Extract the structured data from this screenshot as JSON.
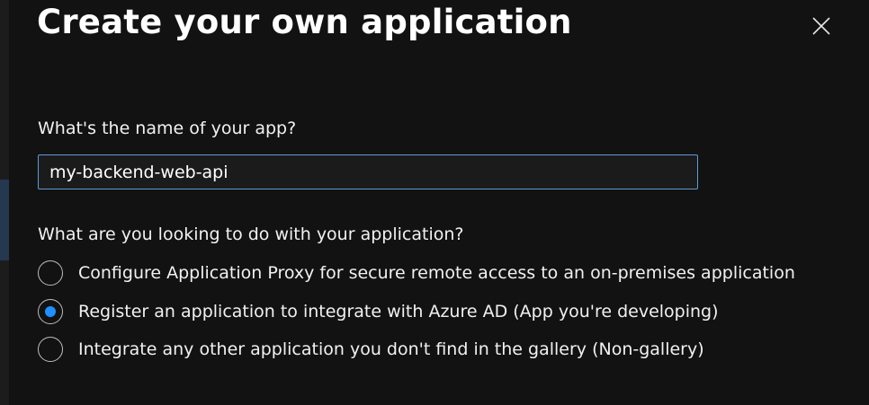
{
  "dialog": {
    "title": "Create your own application",
    "close_icon": "close-icon"
  },
  "name_field": {
    "label": "What's the name of your app?",
    "value": "my-backend-web-api"
  },
  "purpose": {
    "label": "What are you looking to do with your application?",
    "options": [
      {
        "label": "Configure Application Proxy for secure remote access to an on-premises application",
        "selected": false
      },
      {
        "label": "Register an application to integrate with Azure AD (App you're developing)",
        "selected": true
      },
      {
        "label": "Integrate any other application you don't find in the gallery (Non-gallery)",
        "selected": false
      }
    ]
  },
  "colors": {
    "background": "#121212",
    "accent": "#1e90ff",
    "input_border": "#5f9ad6"
  }
}
